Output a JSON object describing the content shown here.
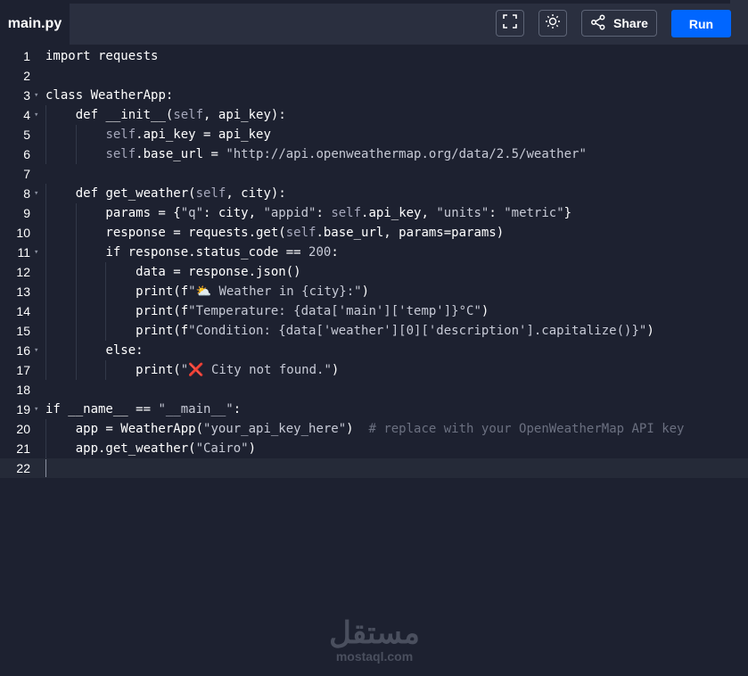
{
  "header": {
    "tab_label": "main.py",
    "share_label": "Share",
    "run_label": "Run",
    "icons": [
      "fullscreen-icon",
      "sun-icon",
      "share-icon"
    ]
  },
  "colors": {
    "background": "#1d2130",
    "run_button": "#0066ff",
    "active_line": "#252a38"
  },
  "editor": {
    "line_numbers": [
      "1",
      "2",
      "3",
      "4",
      "5",
      "6",
      "7",
      "8",
      "9",
      "10",
      "11",
      "12",
      "13",
      "14",
      "15",
      "16",
      "17",
      "18",
      "19",
      "20",
      "21",
      "22"
    ],
    "fold_lines": [
      3,
      4,
      8,
      11,
      16,
      19
    ],
    "active_line": 22,
    "lines": [
      "import requests",
      "",
      "class WeatherApp:",
      "    def __init__(self, api_key):",
      "        self.api_key = api_key",
      "        self.base_url = \"http://api.openweathermap.org/data/2.5/weather\"",
      "",
      "    def get_weather(self, city):",
      "        params = {\"q\": city, \"appid\": self.api_key, \"units\": \"metric\"}",
      "        response = requests.get(self.base_url, params=params)",
      "        if response.status_code == 200:",
      "            data = response.json()",
      "            print(f\"⛅ Weather in {city}:\")",
      "            print(f\"Temperature: {data['main']['temp']}°C\")",
      "            print(f\"Condition: {data['weather'][0]['description'].capitalize()}\")",
      "        else:",
      "            print(\"❌ City not found.\")",
      "",
      "if __name__ == \"__main__\":",
      "    app = WeatherApp(\"your_api_key_here\")  # replace with your OpenWeatherMap API key",
      "    app.get_weather(\"Cairo\")",
      ""
    ]
  },
  "watermark": {
    "arabic": "مستقل",
    "latin": "mostaql.com"
  }
}
